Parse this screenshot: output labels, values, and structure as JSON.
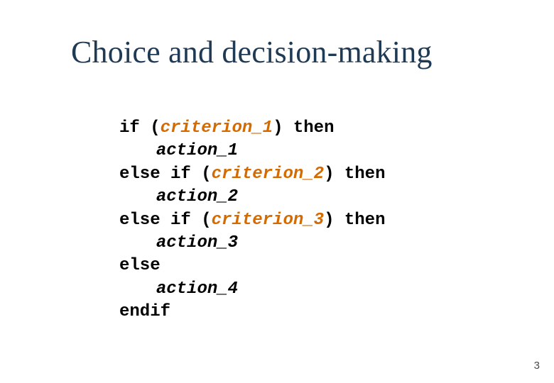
{
  "title": "Choice and decision-making",
  "code": {
    "if": "if ",
    "lp1": "(",
    "crit1": "criterion_1",
    "rp_then1": ") then",
    "act1": "action_1",
    "elseif1": "else if ",
    "lp2": "(",
    "crit2": "criterion_2",
    "rp_then2": ") then",
    "act2": "action_2",
    "elseif2": "else if ",
    "lp3": "(",
    "crit3": "criterion_3",
    "rp_then3": ") then",
    "act3": "action_3",
    "else": "else",
    "act4": "action_4",
    "endif": "endif"
  },
  "page_number": "3"
}
